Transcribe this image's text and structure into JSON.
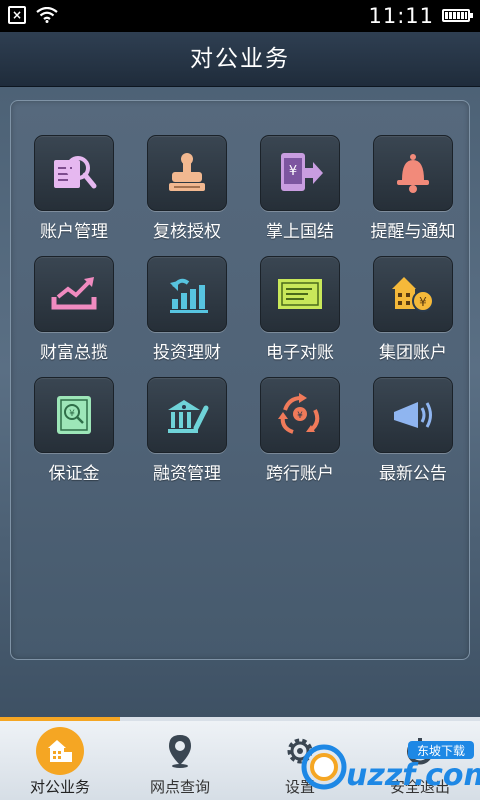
{
  "status_bar": {
    "time": "11:11"
  },
  "title": "对公业务",
  "menu": [
    {
      "label": "账户管理",
      "icon": "account-search-icon"
    },
    {
      "label": "复核授权",
      "icon": "stamp-icon"
    },
    {
      "label": "掌上国结",
      "icon": "yen-transfer-icon"
    },
    {
      "label": "提醒与通知",
      "icon": "bell-icon"
    },
    {
      "label": "财富总揽",
      "icon": "wealth-trend-icon"
    },
    {
      "label": "投资理财",
      "icon": "investment-chart-icon"
    },
    {
      "label": "电子对账",
      "icon": "statement-card-icon"
    },
    {
      "label": "集团账户",
      "icon": "group-building-icon"
    },
    {
      "label": "保证金",
      "icon": "deposit-certificate-icon"
    },
    {
      "label": "融资管理",
      "icon": "financing-bank-icon"
    },
    {
      "label": "跨行账户",
      "icon": "interbank-cycle-icon"
    },
    {
      "label": "最新公告",
      "icon": "megaphone-icon"
    }
  ],
  "bottom_nav": [
    {
      "label": "对公业务",
      "icon": "building-icon",
      "active": true
    },
    {
      "label": "网点查询",
      "icon": "location-pin-icon",
      "active": false
    },
    {
      "label": "设置",
      "icon": "gear-icon",
      "active": false
    },
    {
      "label": "安全退出",
      "icon": "power-icon",
      "active": false
    }
  ],
  "watermark": {
    "brand": "uzzf.com",
    "tagline": "东坡下载"
  },
  "colors": {
    "accent": "#f5a623",
    "bg": "#4d6276"
  }
}
